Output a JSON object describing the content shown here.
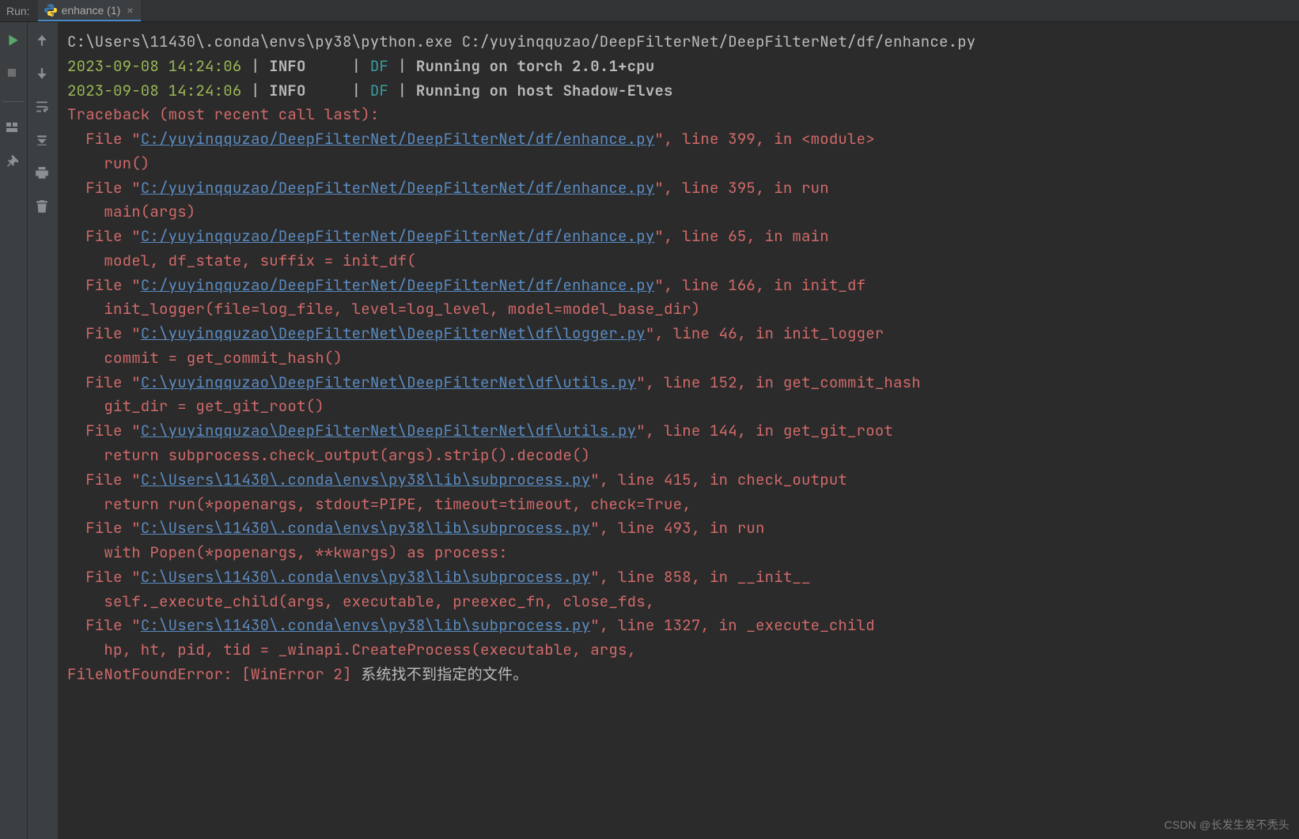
{
  "header": {
    "run_label": "Run:",
    "tab_name": "enhance (1)"
  },
  "console": {
    "command": "C:\\Users\\11430\\.conda\\envs\\py38\\python.exe C:/yuyinqquzao/DeepFilterNet/DeepFilterNet/df/enhance.py",
    "logs": [
      {
        "ts": "2023-09-08 14:24:06",
        "level": "INFO",
        "tag": "DF",
        "msg": "Running on torch 2.0.1+cpu"
      },
      {
        "ts": "2023-09-08 14:24:06",
        "level": "INFO",
        "tag": "DF",
        "msg": "Running on host Shadow-Elves"
      }
    ],
    "traceback_header": "Traceback (most recent call last):",
    "frames": [
      {
        "path": "C:/yuyinqquzao/DeepFilterNet/DeepFilterNet/df/enhance.py",
        "line": "399",
        "fn": "<module>",
        "code": "run()"
      },
      {
        "path": "C:/yuyinqquzao/DeepFilterNet/DeepFilterNet/df/enhance.py",
        "line": "395",
        "fn": "run",
        "code": "main(args)"
      },
      {
        "path": "C:/yuyinqquzao/DeepFilterNet/DeepFilterNet/df/enhance.py",
        "line": "65",
        "fn": "main",
        "code": "model, df_state, suffix = init_df("
      },
      {
        "path": "C:/yuyinqquzao/DeepFilterNet/DeepFilterNet/df/enhance.py",
        "line": "166",
        "fn": "init_df",
        "code": "init_logger(file=log_file, level=log_level, model=model_base_dir)"
      },
      {
        "path": "C:\\yuyinqquzao\\DeepFilterNet\\DeepFilterNet\\df\\logger.py",
        "line": "46",
        "fn": "init_logger",
        "code": "commit = get_commit_hash()"
      },
      {
        "path": "C:\\yuyinqquzao\\DeepFilterNet\\DeepFilterNet\\df\\utils.py",
        "line": "152",
        "fn": "get_commit_hash",
        "code": "git_dir = get_git_root()"
      },
      {
        "path": "C:\\yuyinqquzao\\DeepFilterNet\\DeepFilterNet\\df\\utils.py",
        "line": "144",
        "fn": "get_git_root",
        "code": "return subprocess.check_output(args).strip().decode()"
      },
      {
        "path": "C:\\Users\\11430\\.conda\\envs\\py38\\lib\\subprocess.py",
        "line": "415",
        "fn": "check_output",
        "code": "return run(*popenargs, stdout=PIPE, timeout=timeout, check=True,"
      },
      {
        "path": "C:\\Users\\11430\\.conda\\envs\\py38\\lib\\subprocess.py",
        "line": "493",
        "fn": "run",
        "code": "with Popen(*popenargs, **kwargs) as process:"
      },
      {
        "path": "C:\\Users\\11430\\.conda\\envs\\py38\\lib\\subprocess.py",
        "line": "858",
        "fn": "__init__",
        "code": "self._execute_child(args, executable, preexec_fn, close_fds,"
      },
      {
        "path": "C:\\Users\\11430\\.conda\\envs\\py38\\lib\\subprocess.py",
        "line": "1327",
        "fn": "_execute_child",
        "code": "hp, ht, pid, tid = _winapi.CreateProcess(executable, args,"
      }
    ],
    "error_type": "FileNotFoundError: [WinError 2]",
    "error_msg": " 系统找不到指定的文件。"
  },
  "watermark": "CSDN @长发生发不秃头"
}
